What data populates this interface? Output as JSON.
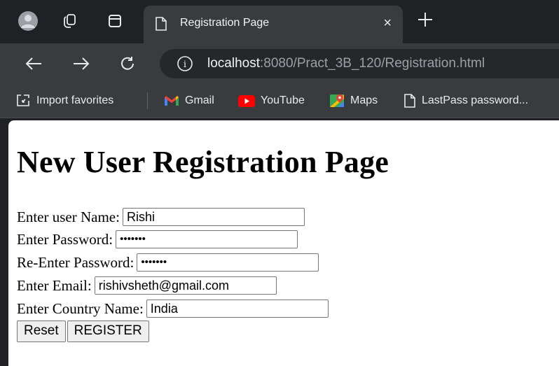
{
  "browser": {
    "tab": {
      "title": "Registration Page",
      "close": "×"
    },
    "new_tab": "+",
    "url": {
      "host": "localhost",
      "path": ":8080/Pract_3B_120/Registration.html"
    },
    "info_icon": "i",
    "bookmarks": [
      {
        "label": "Import favorites",
        "icon": "import-icon"
      },
      {
        "label": "Gmail",
        "icon": "gmail-icon"
      },
      {
        "label": "YouTube",
        "icon": "youtube-icon"
      },
      {
        "label": "Maps",
        "icon": "maps-icon"
      },
      {
        "label": "LastPass password...",
        "icon": "page-icon"
      }
    ]
  },
  "page": {
    "heading": "New User Registration Page",
    "fields": {
      "username": {
        "label": "Enter user Name:",
        "value": "Rishi"
      },
      "password": {
        "label": "Enter Password:",
        "value": "•••••••"
      },
      "reenter_password": {
        "label": "Re-Enter Password:",
        "value": "•••••••"
      },
      "email": {
        "label": "Enter Email:",
        "value": "rishivsheth@gmail.com"
      },
      "country": {
        "label": "Enter Country Name:",
        "value": "India"
      }
    },
    "buttons": {
      "reset": "Reset",
      "register": "REGISTER"
    }
  },
  "colors": {
    "frame": "#202124",
    "toolbar": "#3a3b3e",
    "omnibox": "#26272a",
    "page_bg": "#ffffff"
  }
}
